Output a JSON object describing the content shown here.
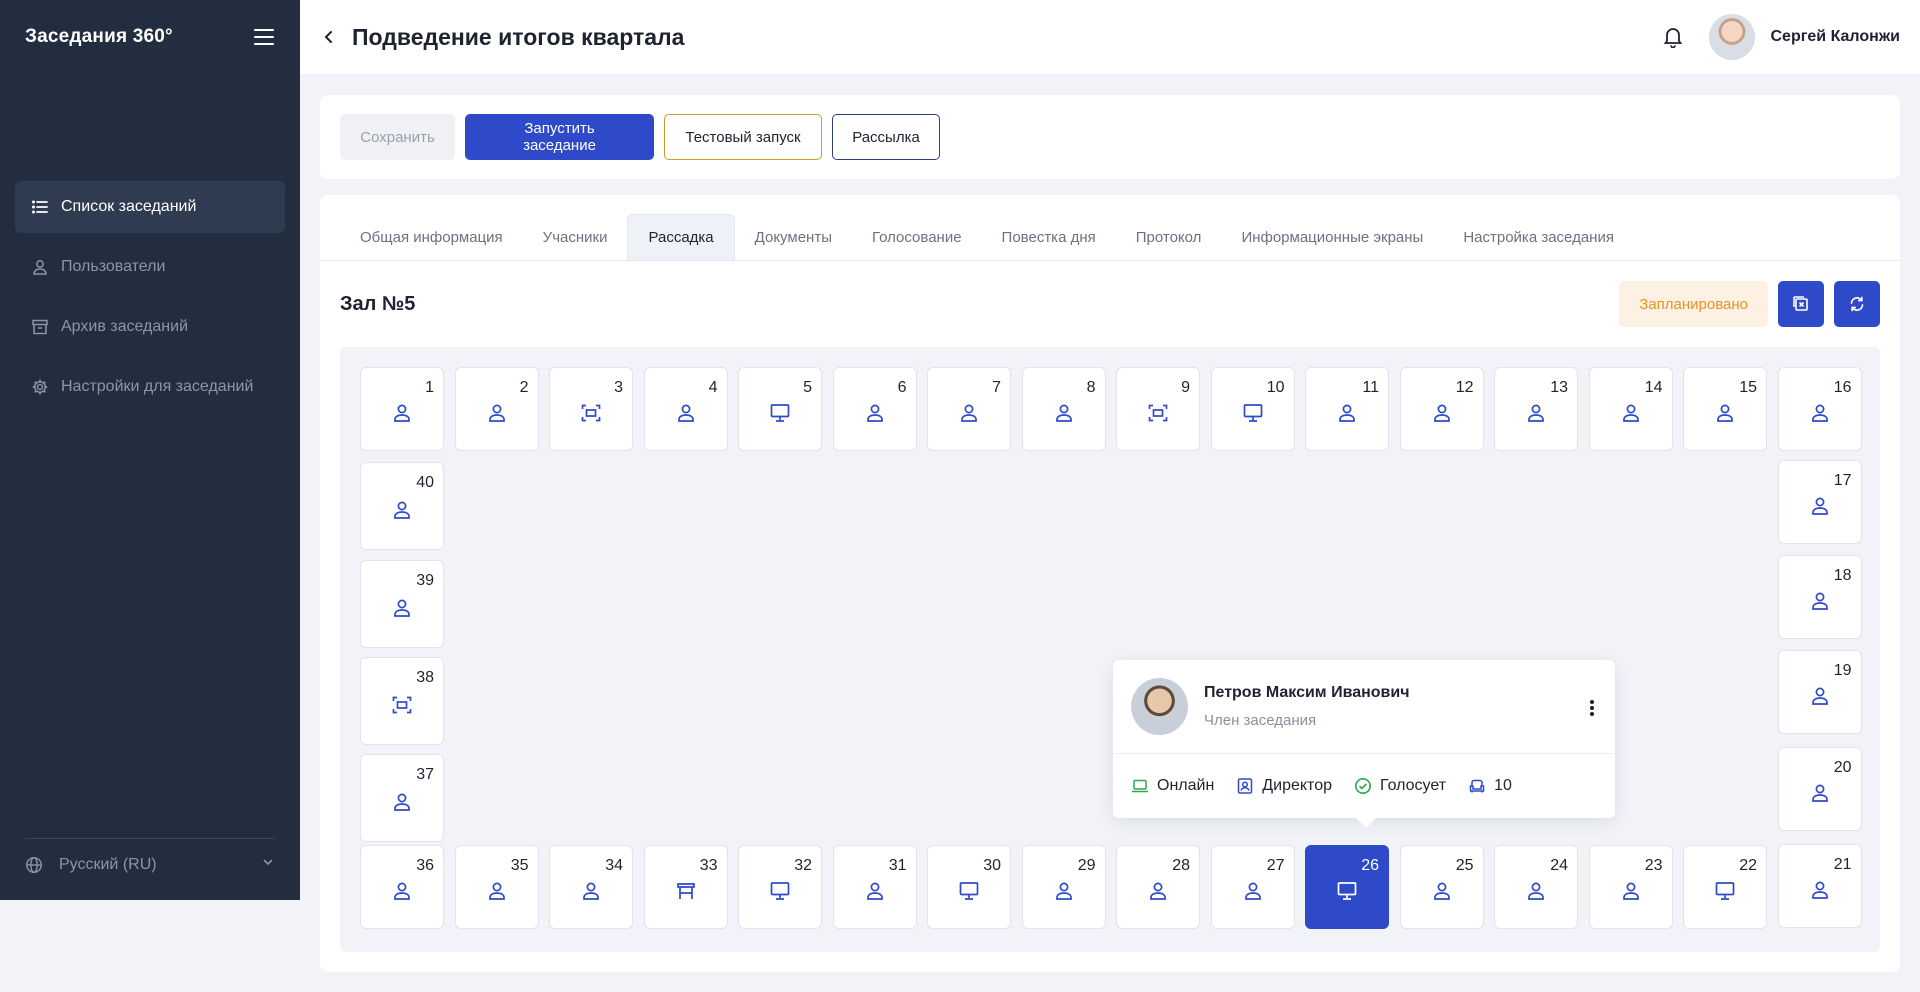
{
  "app": {
    "title": "Заседания 360°"
  },
  "sidebar": {
    "items": [
      {
        "label": "Список заседаний",
        "icon": "list-icon",
        "active": true
      },
      {
        "label": "Пользователи",
        "icon": "user-icon",
        "active": false
      },
      {
        "label": "Архив заседаний",
        "icon": "archive-icon",
        "active": false
      },
      {
        "label": "Настройки для заседаний",
        "icon": "gear-icon",
        "active": false
      }
    ],
    "language": "Русский (RU)"
  },
  "header": {
    "title": "Подведение итогов квартала",
    "user_name": "Сергей Калонжи"
  },
  "actions": {
    "save": "Сохранить",
    "start": "Запустить заседание",
    "test": "Тестовый запуск",
    "mailing": "Рассылка"
  },
  "tabs": [
    {
      "label": "Общая информация",
      "active": false
    },
    {
      "label": "Учасники",
      "active": false
    },
    {
      "label": "Рассадка",
      "active": true
    },
    {
      "label": "Документы",
      "active": false
    },
    {
      "label": "Голосование",
      "active": false
    },
    {
      "label": "Повестка дня",
      "active": false
    },
    {
      "label": "Протокол",
      "active": false
    },
    {
      "label": "Информационные экраны",
      "active": false
    },
    {
      "label": "Настройка заседания",
      "active": false
    }
  ],
  "hall": {
    "title": "Зал №5",
    "status": "Запланировано"
  },
  "seats": [
    {
      "num": "1",
      "type": "person"
    },
    {
      "num": "2",
      "type": "person"
    },
    {
      "num": "3",
      "type": "screen"
    },
    {
      "num": "4",
      "type": "person"
    },
    {
      "num": "5",
      "type": "monitor"
    },
    {
      "num": "6",
      "type": "person"
    },
    {
      "num": "7",
      "type": "person"
    },
    {
      "num": "8",
      "type": "person"
    },
    {
      "num": "9",
      "type": "screen"
    },
    {
      "num": "10",
      "type": "monitor"
    },
    {
      "num": "11",
      "type": "person"
    },
    {
      "num": "12",
      "type": "person"
    },
    {
      "num": "13",
      "type": "person"
    },
    {
      "num": "14",
      "type": "person"
    },
    {
      "num": "15",
      "type": "person"
    },
    {
      "num": "16",
      "type": "person"
    },
    {
      "num": "17",
      "type": "person"
    },
    {
      "num": "18",
      "type": "person"
    },
    {
      "num": "19",
      "type": "person"
    },
    {
      "num": "20",
      "type": "person"
    },
    {
      "num": "21",
      "type": "person"
    },
    {
      "num": "22",
      "type": "monitor"
    },
    {
      "num": "23",
      "type": "person"
    },
    {
      "num": "24",
      "type": "person"
    },
    {
      "num": "25",
      "type": "person"
    },
    {
      "num": "26",
      "type": "monitor",
      "selected": true
    },
    {
      "num": "27",
      "type": "person"
    },
    {
      "num": "28",
      "type": "person"
    },
    {
      "num": "29",
      "type": "person"
    },
    {
      "num": "30",
      "type": "monitor"
    },
    {
      "num": "31",
      "type": "person"
    },
    {
      "num": "32",
      "type": "monitor"
    },
    {
      "num": "33",
      "type": "podium"
    },
    {
      "num": "34",
      "type": "person"
    },
    {
      "num": "35",
      "type": "person"
    },
    {
      "num": "36",
      "type": "person"
    },
    {
      "num": "37",
      "type": "person"
    },
    {
      "num": "38",
      "type": "screen"
    },
    {
      "num": "39",
      "type": "person"
    },
    {
      "num": "40",
      "type": "person"
    }
  ],
  "popup": {
    "name": "Петров Максим Иванович",
    "role": "Член заседания",
    "mode": "Онлайн",
    "position": "Директор",
    "vote": "Голосует",
    "seat": "10",
    "colors": {
      "online": "#2aa84a",
      "vote": "#2aa84a",
      "accent": "#2e4ac9"
    }
  },
  "colors": {
    "sidebar": "#222d3f",
    "primary": "#2e4ac9",
    "warning": "#e89227"
  }
}
